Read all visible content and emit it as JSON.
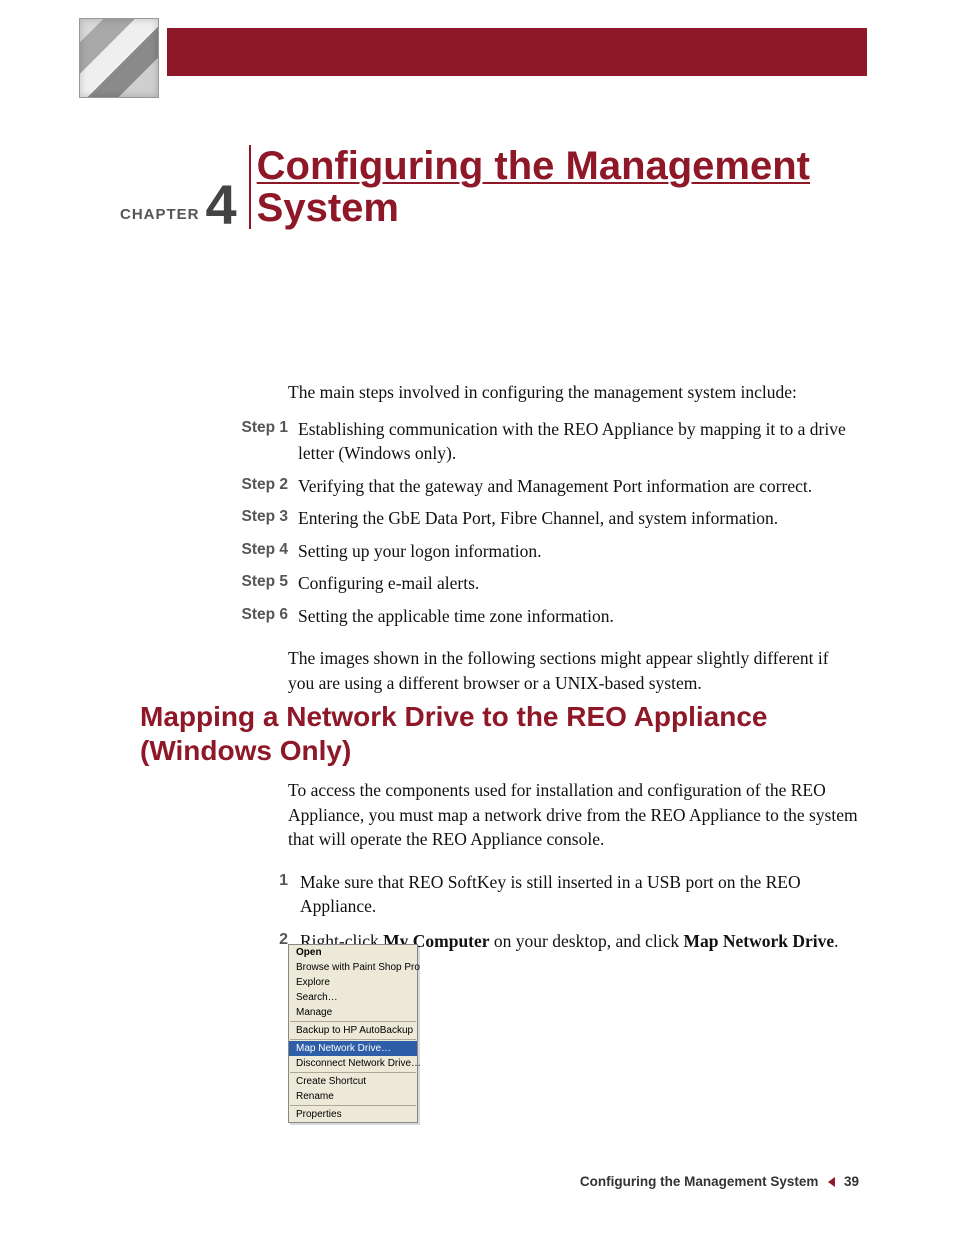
{
  "chapter": {
    "label": "CHAPTER",
    "number": "4",
    "title_line1": "Configuring the Management",
    "title_line2": "System"
  },
  "intro": "The main steps involved in configuring the management system include:",
  "steps": {
    "s1": {
      "label": "Step 1",
      "text": "Establishing communication with the REO Appliance by mapping it to a drive letter (Windows only)."
    },
    "s2": {
      "label": "Step 2",
      "text": "Verifying that the gateway and Management Port information are correct."
    },
    "s3": {
      "label": "Step 3",
      "text": "Entering the GbE Data Port, Fibre Channel, and system information."
    },
    "s4": {
      "label": "Step 4",
      "text": "Setting up your logon information."
    },
    "s5": {
      "label": "Step 5",
      "text": "Configuring e-mail alerts."
    },
    "s6": {
      "label": "Step 6",
      "text": "Setting the applicable time zone information."
    }
  },
  "note": "The images shown in the following sections might appear slightly different if you are using a different browser or a UNIX-based system.",
  "section_heading": "Mapping a Network Drive to the REO Appliance (Windows Only)",
  "section_para": "To access the components used for installation and configuration of the REO Appliance, you must map a network drive from the REO Appliance to the system that will operate the REO Appliance console.",
  "numbered": {
    "n1": {
      "label": "1",
      "text": "Make sure that REO SoftKey is still inserted in a USB port on the REO Appliance."
    },
    "n2": {
      "label": "2",
      "pre": "Right-click ",
      "b1": "My Computer",
      "mid": " on your desktop, and click ",
      "b2": "Map Network Drive",
      "post": "."
    }
  },
  "context_menu": {
    "open": "Open",
    "browse": "Browse with Paint Shop Pro",
    "explore": "Explore",
    "search": "Search…",
    "manage": "Manage",
    "backup": "Backup to HP AutoBackup",
    "map": "Map Network Drive…",
    "disconnect": "Disconnect Network Drive…",
    "shortcut": "Create Shortcut",
    "rename": "Rename",
    "properties": "Properties"
  },
  "footer": {
    "text": "Configuring the Management System",
    "page": "39"
  }
}
